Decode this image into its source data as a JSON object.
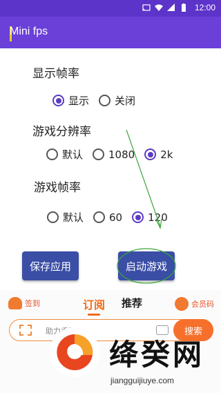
{
  "status_bar": {
    "time": "12:00",
    "icons": [
      "cast-icon",
      "wifi-icon",
      "signal-icon",
      "battery-icon"
    ],
    "bg_color": "#5d34c9"
  },
  "app_bar": {
    "title": "Mini fps",
    "bg_color": "#6a40d9"
  },
  "sections": {
    "display_fps": {
      "title": "显示帧率",
      "options": [
        {
          "label": "显示",
          "checked": true
        },
        {
          "label": "关闭",
          "checked": false
        }
      ]
    },
    "resolution": {
      "title": "游戏分辨率",
      "options": [
        {
          "label": "默认",
          "checked": false
        },
        {
          "label": "1080",
          "checked": false
        },
        {
          "label": "2k",
          "checked": true
        }
      ]
    },
    "game_fps": {
      "title": "游戏帧率",
      "options": [
        {
          "label": "默认",
          "checked": false
        },
        {
          "label": "60",
          "checked": false
        },
        {
          "label": "120",
          "checked": true
        }
      ]
    }
  },
  "buttons": {
    "save": "保存应用",
    "launch": "启动游戏",
    "color": "#3a4ea6"
  },
  "ad_panel": {
    "sign_in": "签到",
    "tab_subscribe": "订阅",
    "tab_recommend": "推荐",
    "vip": "会员码",
    "search_placeholder": "助力手游",
    "search_button": "搜索",
    "accent_color": "#f7702b"
  },
  "watermark": {
    "title": "绛癸网",
    "domain": "jiangguijiuye.com"
  }
}
